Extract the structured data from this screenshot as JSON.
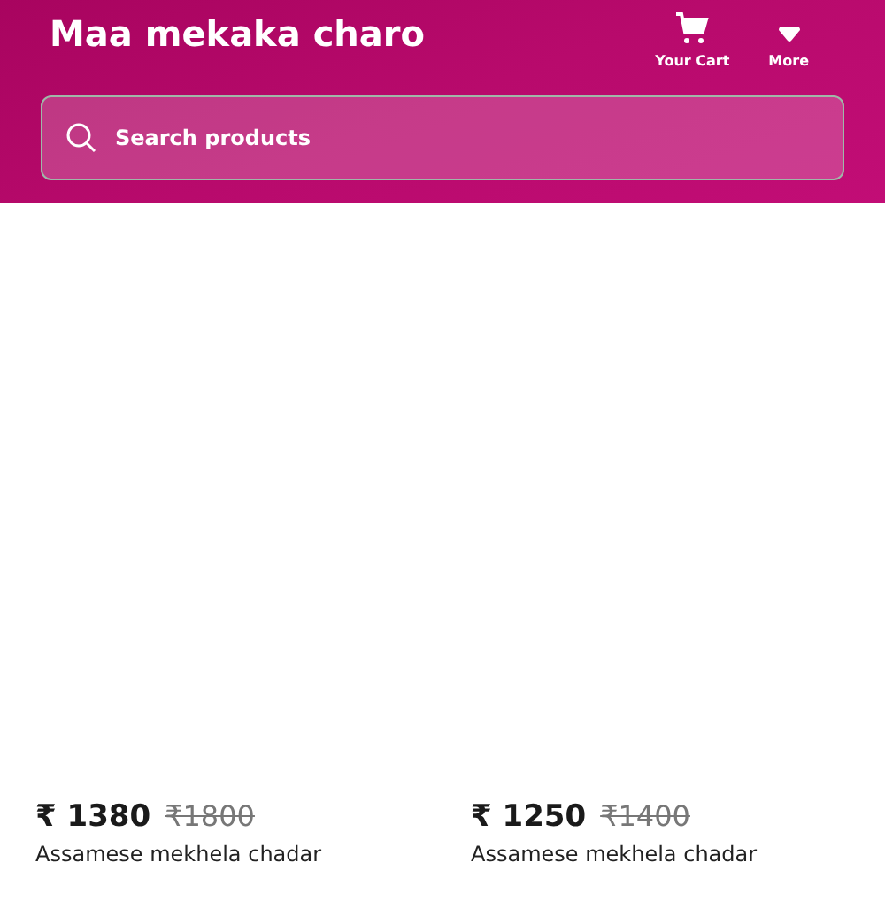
{
  "header": {
    "title": "Maa mekaka charo",
    "actions": [
      {
        "kind": "cart",
        "label": "Your Cart"
      },
      {
        "kind": "more",
        "label": "More"
      }
    ]
  },
  "search": {
    "placeholder": "Search products"
  },
  "products": [
    {
      "price": "₹ 1380",
      "old_price": "₹1800",
      "name": "Assamese mekhela chadar"
    },
    {
      "price": "₹ 1250",
      "old_price": "₹1400",
      "name": "Assamese mekhela chadar"
    }
  ]
}
